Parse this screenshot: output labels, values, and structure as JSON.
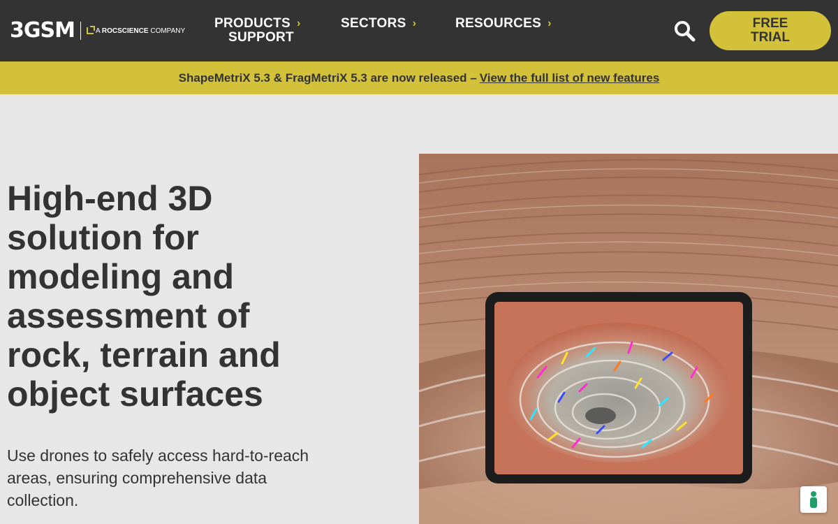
{
  "nav": {
    "logo_mark": "3GSM",
    "logo_prefix": "A",
    "logo_brand": "ROCSCIENCE",
    "logo_suffix": "COMPANY",
    "products_label": "PRODUCTS",
    "support_label": "SUPPORT",
    "sectors_label": "SECTORS",
    "resources_label": "RESOURCES",
    "chevron_icon": "chevron-right-icon",
    "search_icon": "search-icon",
    "trial_line1": "FREE",
    "trial_line2": "TRIAL"
  },
  "announcement": {
    "text": "ShapeMetriX 5.3 & FragMetriX 5.3 are now released –",
    "link": "View the full list of new features"
  },
  "hero": {
    "title": "High-end 3D solution for modeling and assessment of rock, terrain and object surfaces",
    "subtitle": "Use drones to safely access hard-to-reach areas, ensuring comprehensive data collection."
  },
  "colors": {
    "nav_bg": "#333333",
    "accent": "#d4c13a",
    "page_bg": "#e7e7e7",
    "text": "#333333"
  },
  "chat_widget_icon": "accessibility-person-icon"
}
